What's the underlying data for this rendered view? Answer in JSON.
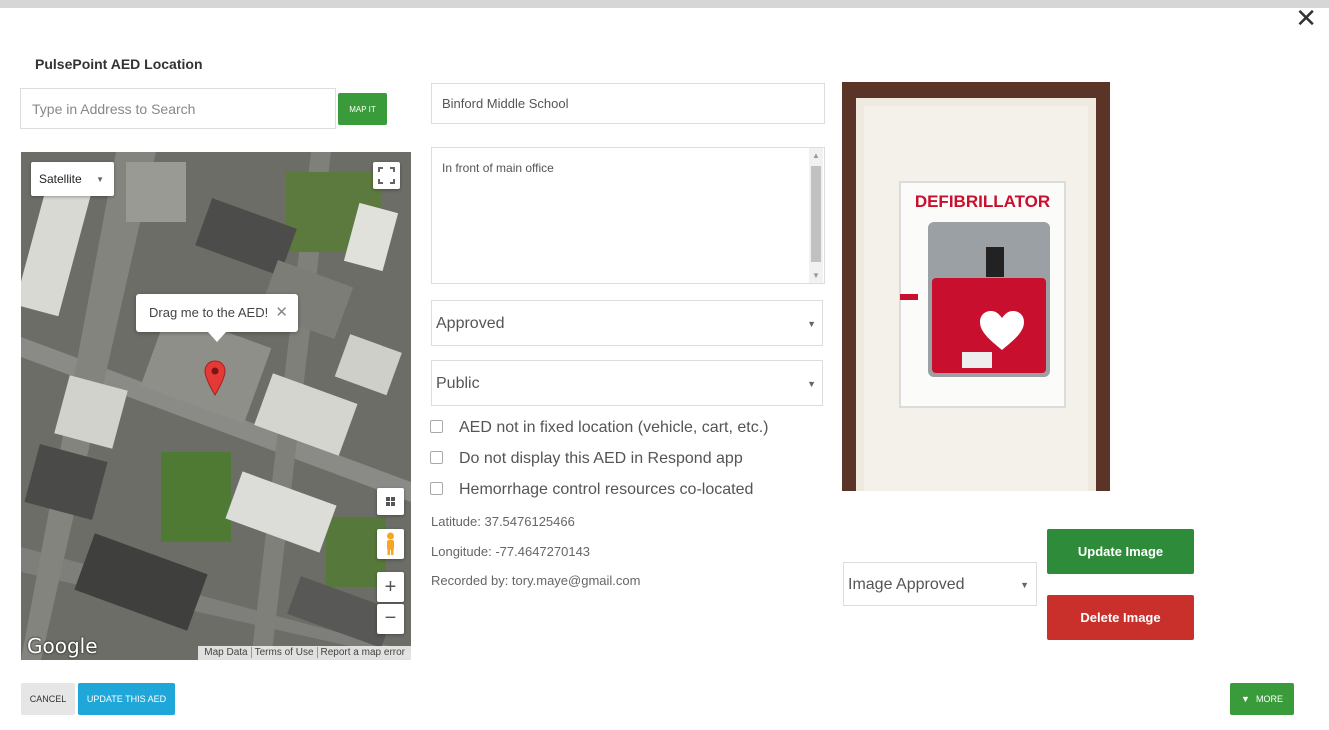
{
  "window": {
    "close_icon": "close-icon",
    "close_glyph": "✕"
  },
  "header": {
    "title": "PulsePoint AED Location"
  },
  "search": {
    "placeholder": "Type in Address to Search",
    "button_label": "MAP IT"
  },
  "map": {
    "map_type": "Satellite",
    "tooltip": "Drag me to the AED!",
    "tooltip_close": "✕",
    "zoom_in": "+",
    "zoom_out": "−",
    "logo": "Google",
    "attribution": [
      "Map Data",
      "Terms of Use",
      "Report a map error"
    ],
    "icons": [
      "fullscreen-icon",
      "map-pin-icon",
      "pegman-icon",
      "tiles-icon"
    ]
  },
  "aed": {
    "name": "Binford Middle School",
    "description": "In front of main office",
    "status": "Approved",
    "access": "Public",
    "options": [
      {
        "label": "AED not in fixed location (vehicle, cart, etc.)",
        "checked": false
      },
      {
        "label": "Do not display this AED in Respond app",
        "checked": false
      },
      {
        "label": "Hemorrhage control resources co-located",
        "checked": false
      }
    ],
    "latitude": "Latitude: 37.5476125466",
    "longitude": "Longitude: -77.4647270143",
    "recorded_by": "Recorded by: tory.maye@gmail.com"
  },
  "image": {
    "sign_text": "DEFIBRILLATOR",
    "status": "Image Approved",
    "update_label": "Update Image",
    "delete_label": "Delete Image"
  },
  "footer": {
    "cancel_label": "CANCEL",
    "update_label": "UPDATE THIS AED",
    "more_label": "MORE"
  },
  "colors": {
    "green": "#3a9b3a",
    "dark_green": "#2e8b3a",
    "red": "#c9302c",
    "blue": "#1fa7d9",
    "pin_red": "#e53935"
  }
}
